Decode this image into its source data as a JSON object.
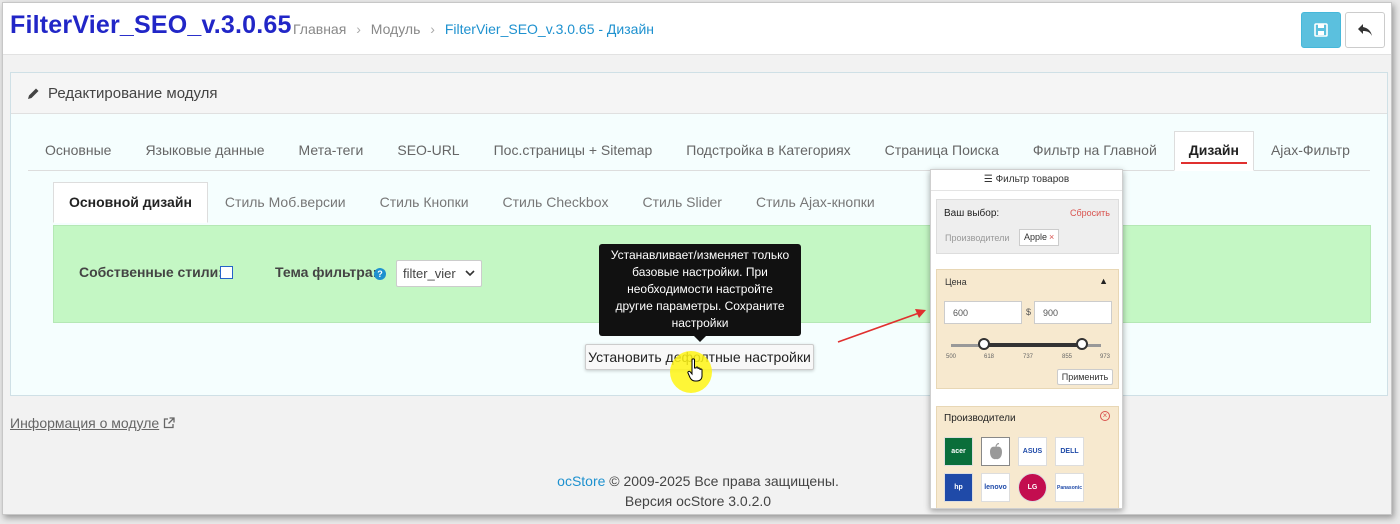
{
  "header": {
    "title": "FilterVier_SEO_v.3.0.65",
    "breadcrumbs": [
      "Главная",
      "Модуль",
      "FilterVier_SEO_v.3.0.65 - Дизайн"
    ],
    "separator": "›"
  },
  "panel": {
    "heading": "Редактирование модуля"
  },
  "tabs": [
    "Основные",
    "Языковые данные",
    "Мета-теги",
    "SEO-URL",
    "Пос.страницы + Sitemap",
    "Подстройка в Категориях",
    "Страница Поиска",
    "Фильтр на Главной",
    "Дизайн",
    "Ajax-Фильтр"
  ],
  "subtabs": [
    "Основной дизайн",
    "Стиль Моб.версии",
    "Стиль Кнопки",
    "Стиль Checkbox",
    "Стиль Slider",
    "Стиль Ajax-кнопки"
  ],
  "form": {
    "own_styles_label": "Собственные стили:",
    "own_styles_checked": false,
    "theme_label": "Тема фильтра:",
    "theme_value": "filter_vier",
    "help_glyph": "?"
  },
  "tooltip": "Устанавливает/изменяет только базовые настройки. При необходимости настройте другие параметры. Сохраните настройки",
  "default_button": "Установить дефолтные настройки",
  "info_link": "Информация о модуле",
  "footer": {
    "brand": "ocStore",
    "copyright": " © 2009-2025 Все права защищены.",
    "version": "Версия ocStore 3.0.2.0"
  },
  "preview": {
    "title": "☰ Фильтр товаров",
    "choice_label": "Ваш выбор:",
    "reset": "Сбросить",
    "chip_label": "Производители",
    "chip_value": "Apple",
    "chip_remove": "×",
    "price_heading": "Цена",
    "price_caret": "▲",
    "min": "600",
    "max": "900",
    "currency": "$",
    "scale": [
      "500",
      "618",
      "737",
      "855",
      "973"
    ],
    "apply": "Применить",
    "brands_heading": "Производители",
    "brands": [
      "acer",
      "apple",
      "ASUS",
      "DELL",
      "hp",
      "lenovo",
      "LG",
      "Panasonic"
    ]
  },
  "colors": {
    "title": "#2126c7",
    "link": "#1e91cf",
    "active_tab_underline": "#e0302f",
    "green_area": "#c4f7c4",
    "save_button": "#5bc0de"
  }
}
